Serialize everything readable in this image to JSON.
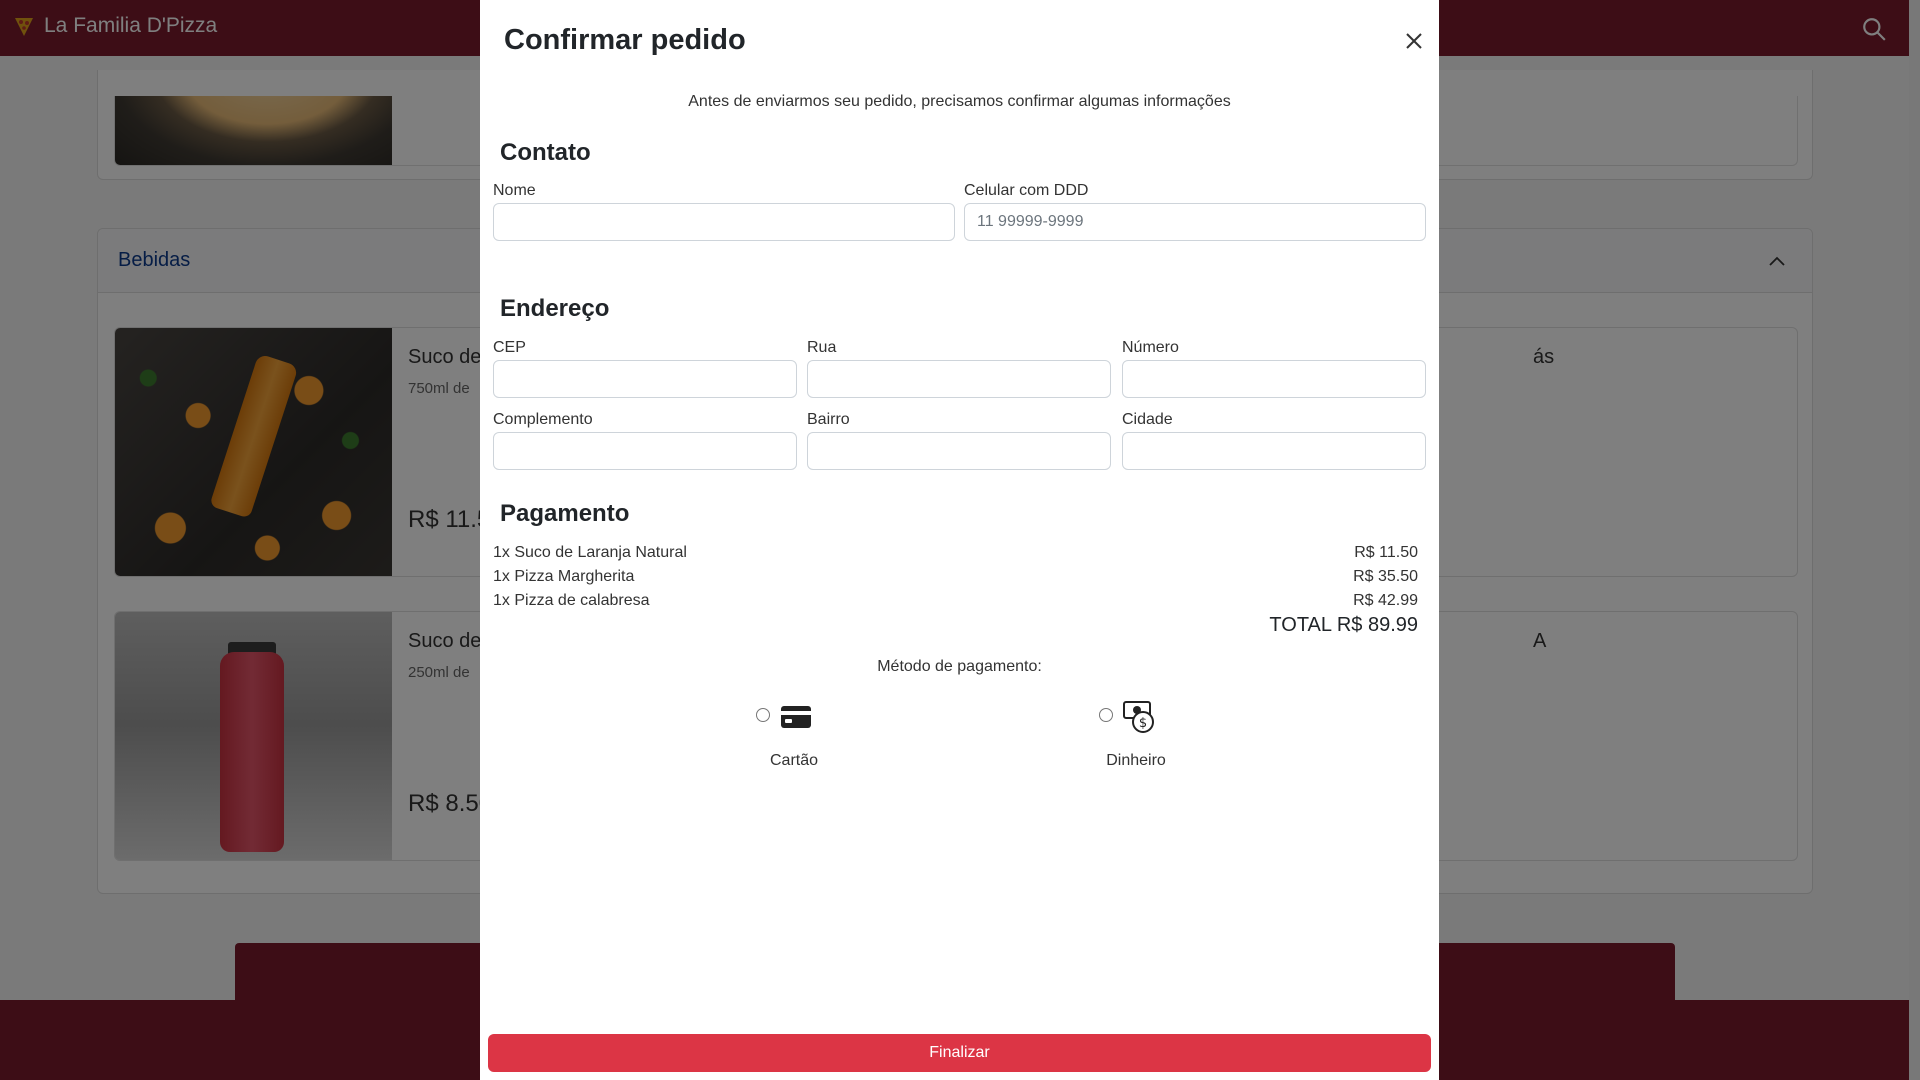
{
  "navbar": {
    "brand": "La Familia D'Pizza",
    "brand_icon": "pizza-logo-icon",
    "search_icon": "search-icon",
    "color": "#7a1a2c"
  },
  "menu": {
    "section_title": "Bebidas",
    "items": [
      {
        "name": "Suco de",
        "desc": "750ml de",
        "price": "R$ 11.5"
      },
      {
        "name": "Suco de",
        "desc": "250ml de",
        "price": "R$ 8.50"
      },
      {
        "name": "ás"
      },
      {
        "name": "A"
      }
    ]
  },
  "modal": {
    "title": "Confirmar pedido",
    "intro": "Antes de enviarmos seu pedido, precisamos confirmar algumas informações",
    "contato": {
      "heading": "Contato",
      "name_label": "Nome",
      "name_value": "",
      "phone_label": "Celular com DDD",
      "phone_placeholder": "11 99999-9999"
    },
    "endereco": {
      "heading": "Endereço",
      "cep_label": "CEP",
      "rua_label": "Rua",
      "numero_label": "Número",
      "complemento_label": "Complemento",
      "bairro_label": "Bairro",
      "cidade_label": "Cidade"
    },
    "pagamento": {
      "heading": "Pagamento",
      "items": [
        {
          "desc": "1x Suco de Laranja Natural",
          "price": "R$ 11.50"
        },
        {
          "desc": "1x Pizza Margherita",
          "price": "R$ 35.50"
        },
        {
          "desc": "1x Pizza de calabresa",
          "price": "R$ 42.99"
        }
      ],
      "total": "TOTAL R$ 89.99",
      "method_label": "Método de pagamento:",
      "methods": [
        {
          "label": "Cartão",
          "icon": "credit-card-icon",
          "selected": false
        },
        {
          "label": "Dinheiro",
          "icon": "cash-icon",
          "selected": false
        }
      ]
    },
    "finish_label": "Finalizar",
    "accent": "#dc3545"
  }
}
